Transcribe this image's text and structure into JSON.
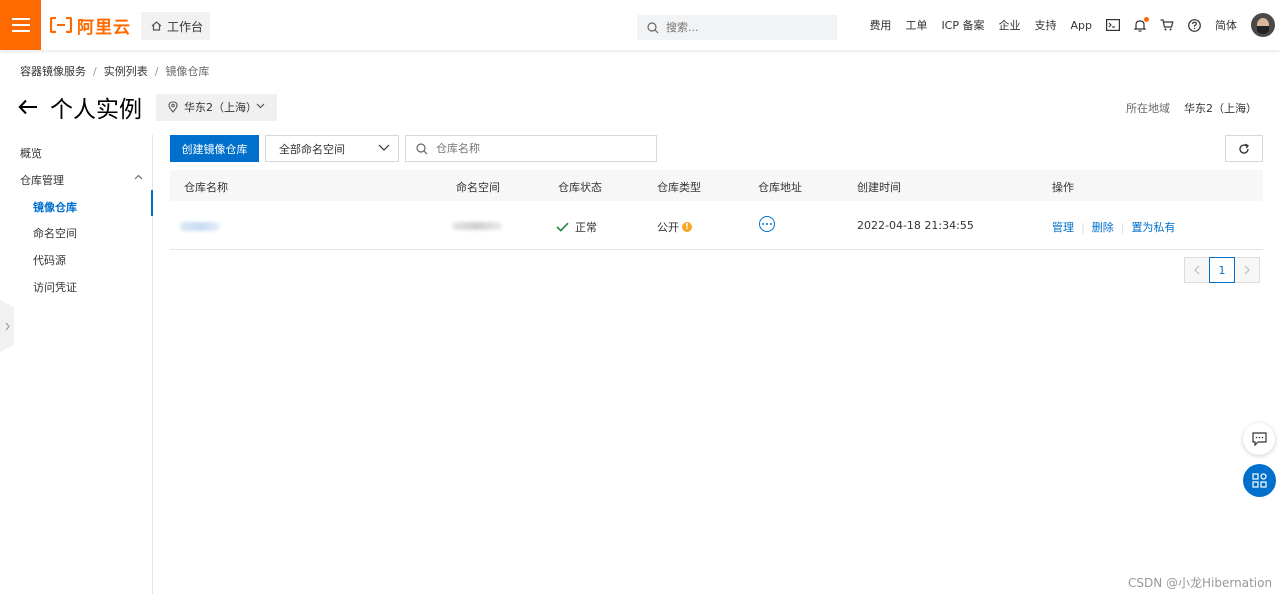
{
  "topbar": {
    "logo_text": "阿里云",
    "workbench_label": "工作台",
    "search_placeholder": "搜索...",
    "nav": [
      "费用",
      "工单",
      "ICP 备案",
      "企业",
      "支持",
      "App"
    ],
    "language": "简体",
    "icons": [
      "terminal-icon",
      "bell-icon",
      "cart-icon",
      "help-icon"
    ]
  },
  "breadcrumb": [
    "容器镜像服务",
    "实例列表",
    "镜像仓库"
  ],
  "page": {
    "title": "个人实例",
    "region_selected": "华东2（上海）",
    "region_label": "所在地域",
    "region_value": "华东2（上海）"
  },
  "sidebar": {
    "overview": "概览",
    "repo_management": "仓库管理",
    "items": [
      "镜像仓库",
      "命名空间",
      "代码源",
      "访问凭证"
    ],
    "active": "镜像仓库"
  },
  "toolbar": {
    "create_label": "创建镜像仓库",
    "namespace_filter": "全部命名空间",
    "search_placeholder": "仓库名称"
  },
  "table": {
    "columns": [
      "仓库名称",
      "命名空间",
      "仓库状态",
      "仓库类型",
      "仓库地址",
      "创建时间",
      "操作"
    ],
    "rows": [
      {
        "status": "正常",
        "type": "公开",
        "created": "2022-04-18 21:34:55",
        "actions": [
          "管理",
          "删除",
          "置为私有"
        ]
      }
    ]
  },
  "pagination": {
    "current": "1"
  },
  "watermark": "CSDN @小龙Hibernation",
  "colors": {
    "brand_orange": "#ff6a00",
    "primary_blue": "#0070cc",
    "success_green": "#1e8e3e",
    "warning_yellow": "#f5a623"
  }
}
